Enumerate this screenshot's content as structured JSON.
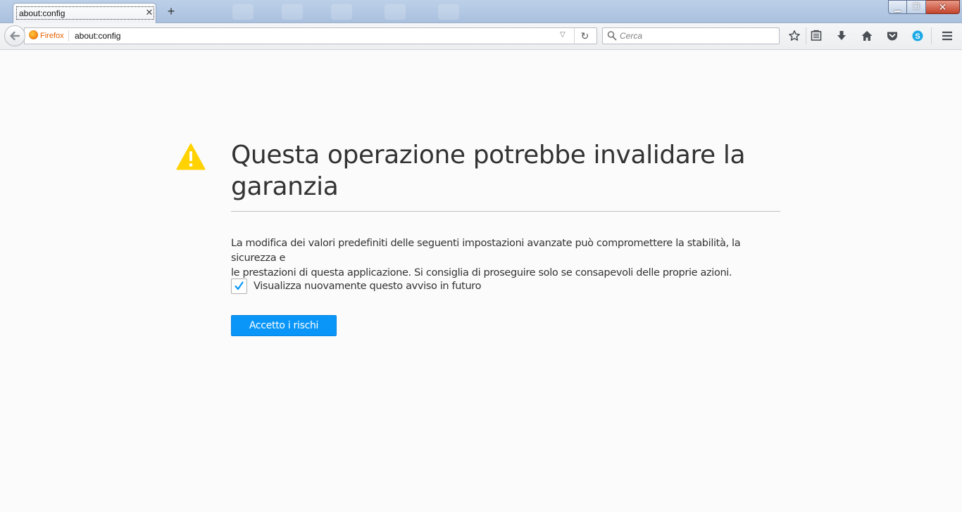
{
  "tab": {
    "title": "about:config",
    "close_icon": "close-icon",
    "new_tab_icon": "plus-icon"
  },
  "window_controls": {
    "minimize": "minimize-icon",
    "maximize": "restore-icon",
    "close": "close-icon"
  },
  "navbar": {
    "identity_label": "Firefox",
    "url": "about:config",
    "search_placeholder": "Cerca",
    "toolbar_icons": [
      "star-icon",
      "reading-list-icon",
      "download-icon",
      "home-icon",
      "pocket-icon",
      "skype-icon",
      "hamburger-menu-icon"
    ]
  },
  "page": {
    "title_line1": "Questa operazione potrebbe invalidare la",
    "title_line2": "garanzia",
    "description_line1": "La modifica dei valori predefiniti delle seguenti impostazioni avanzate può compromettere la stabilità, la sicurezza e",
    "description_line2": "le prestazioni di questa applicazione. Si consiglia di proseguire solo se consapevoli delle proprie azioni.",
    "checkbox_label": "Visualizza nuovamente questo avviso in futuro",
    "checkbox_checked": true,
    "accept_button": "Accetto i rischi"
  },
  "colors": {
    "accent": "#0996f8",
    "warning": "#ffd200",
    "firefox_orange": "#e66000"
  }
}
